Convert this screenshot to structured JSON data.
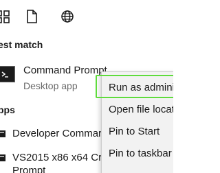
{
  "scope_bar": {
    "icons": [
      "apps-icon",
      "document-icon",
      "globe-icon"
    ]
  },
  "best_match": {
    "heading": "est match",
    "result": {
      "title": "Command Prompt",
      "subtitle": "Desktop app",
      "icon": "command-prompt-icon"
    }
  },
  "apps": {
    "heading": "pps",
    "items": [
      {
        "label": "Developer Commar",
        "icon": "app-icon"
      },
      {
        "label": "VS2015 x86 x64 Cro",
        "label_line2": "Prompt",
        "icon": "app-icon"
      }
    ]
  },
  "context_menu": {
    "items": [
      {
        "label": "Run as admini"
      },
      {
        "label": "Open file locat"
      },
      {
        "label": "Pin to Start"
      },
      {
        "label": "Pin to taskbar"
      }
    ],
    "highlight_color": "#5fdc3c"
  }
}
